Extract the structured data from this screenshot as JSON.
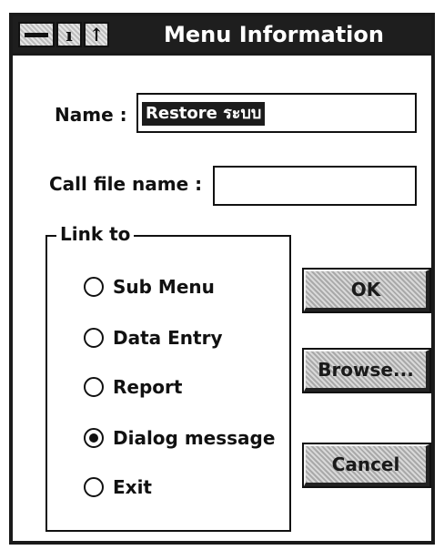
{
  "window": {
    "title": "Menu Information",
    "min_glyph": "ı",
    "max_glyph": "↑"
  },
  "form": {
    "name_label": "Name :",
    "name_value": "Restore ระบบ",
    "call_file_label": "Call file name :",
    "call_file_value": ""
  },
  "link_to": {
    "label": "Link to",
    "options": [
      {
        "label": "Sub Menu",
        "checked": false
      },
      {
        "label": "Data Entry",
        "checked": false
      },
      {
        "label": "Report",
        "checked": false
      },
      {
        "label": "Dialog message",
        "checked": true
      },
      {
        "label": "Exit",
        "checked": false
      }
    ]
  },
  "buttons": {
    "ok": "OK",
    "browse": "Browse...",
    "cancel": "Cancel"
  }
}
